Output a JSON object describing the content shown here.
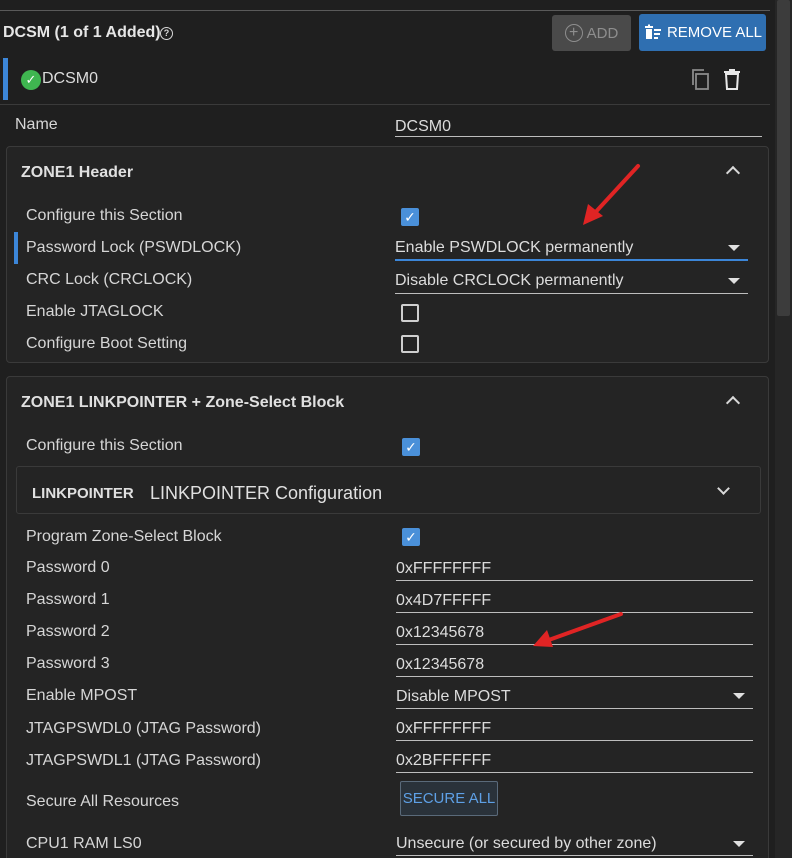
{
  "header": {
    "title": "DCSM (1 of 1 Added)",
    "help_icon": "help-circle-icon",
    "add_label": "ADD",
    "remove_all_label": "REMOVE ALL"
  },
  "instance": {
    "name": "DCSM0",
    "status_icon": "check-circle-icon",
    "status_color": "#3fb650"
  },
  "name_field": {
    "label": "Name",
    "value": "DCSM0"
  },
  "zone1_header": {
    "title": "ZONE1 Header",
    "rows": [
      {
        "label": "Configure this Section",
        "checked": true
      },
      {
        "label": "Password Lock (PSWDLOCK)",
        "value": "Enable PSWDLOCK permanently"
      },
      {
        "label": "CRC Lock (CRCLOCK)",
        "value": "Disable CRCLOCK permanently"
      },
      {
        "label": "Enable JTAGLOCK",
        "checked": false
      },
      {
        "label": "Configure Boot Setting",
        "checked": false
      }
    ]
  },
  "zone1_linkpointer": {
    "title": "ZONE1 LINKPOINTER + Zone-Select Block",
    "configure_label": "Configure this Section",
    "configure_checked": true,
    "linkpointer": {
      "tag": "LINKPOINTER",
      "title": "LINKPOINTER Configuration"
    },
    "rows": [
      {
        "label": "Program Zone-Select Block",
        "checked": true
      },
      {
        "label": "Password 0",
        "value": "0xFFFFFFFF"
      },
      {
        "label": "Password 1",
        "value": "0x4D7FFFFF"
      },
      {
        "label": "Password 2",
        "value": "0x12345678"
      },
      {
        "label": "Password 3",
        "value": "0x12345678"
      },
      {
        "label": "Enable MPOST",
        "value": "Disable MPOST"
      },
      {
        "label": "JTAGPSWDL0 (JTAG Password)",
        "value": "0xFFFFFFFF"
      },
      {
        "label": "JTAGPSWDL1 (JTAG Password)",
        "value": "0x2BFFFFFF"
      },
      {
        "label": "Secure All Resources",
        "button": "SECURE ALL"
      },
      {
        "label": "CPU1 RAM LS0",
        "value": "Unsecure (or secured by other zone)"
      }
    ]
  },
  "colors": {
    "accent": "#3c86d8",
    "annotation_arrow": "#e02424"
  }
}
